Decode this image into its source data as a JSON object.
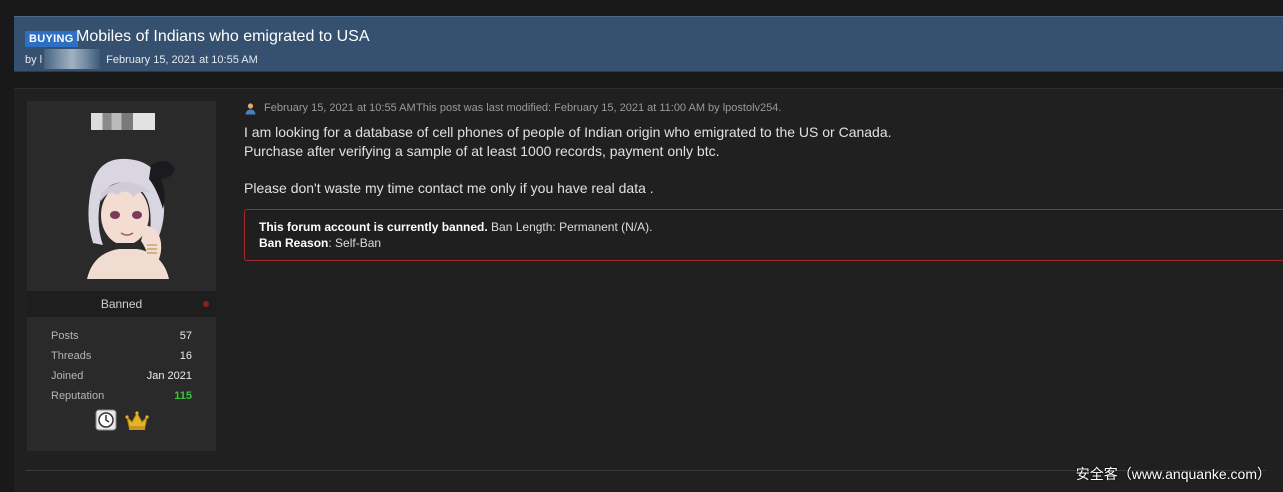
{
  "thread": {
    "badge": "BUYING",
    "title": "Mobiles of Indians who emigrated to USA",
    "by": "by l",
    "date": "February 15, 2021 at 10:55 AM"
  },
  "user": {
    "status": "Banned",
    "stats": [
      {
        "label": "Posts",
        "value": "57"
      },
      {
        "label": "Threads",
        "value": "16"
      },
      {
        "label": "Joined",
        "value": "Jan 2021"
      },
      {
        "label": "Reputation",
        "value": "115"
      }
    ],
    "awards": [
      "clock-badge-icon",
      "crown-icon"
    ]
  },
  "post": {
    "date": "February 15, 2021 at 10:55 AM",
    "modified": "This post was last modified: February 15, 2021 at 11:00 AM by lpostolv254.",
    "lines": [
      "I am looking for a database of cell phones of people of Indian origin who emigrated to the US or Canada.",
      "Purchase after verifying a sample of at least 1000 records, payment only btc.",
      "",
      "Please don't waste my time contact me only if you have real data ."
    ]
  },
  "ban": {
    "line1_bold": "This forum account is currently banned.",
    "line1_rest": " Ban Length: Permanent (N/A).",
    "line2_bold": "Ban Reason",
    "line2_rest": ": Self-Ban"
  },
  "watermark": "安全客（www.anquanke.com）",
  "colors": {
    "header_bg": "#36516f",
    "badge_bg": "#2c6fc4",
    "reputation": "#36c636",
    "ban_border": "#a22a2a"
  }
}
